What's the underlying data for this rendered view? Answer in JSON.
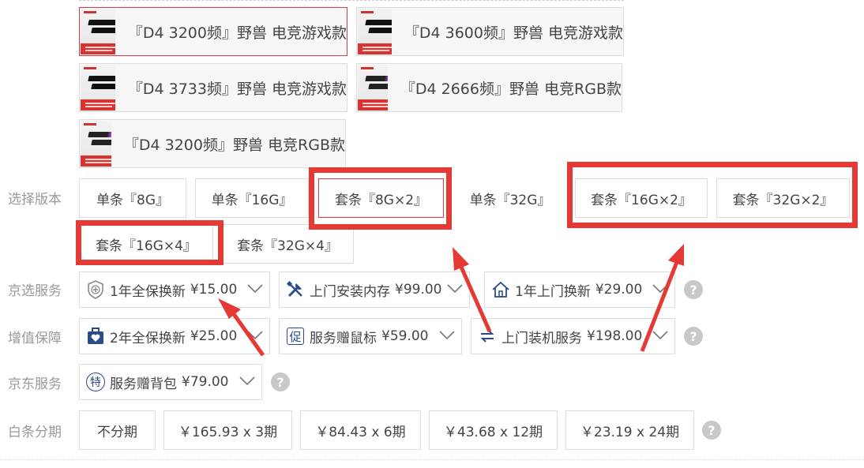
{
  "products": [
    {
      "name": "『D4 3200频』野兽 电竞游戏款",
      "selected": true,
      "rgb": false
    },
    {
      "name": "『D4 3600频』野兽 电竞游戏款",
      "selected": false,
      "rgb": false
    },
    {
      "name": "『D4 3733频』野兽 电竞游戏款",
      "selected": false,
      "rgb": false
    },
    {
      "name": "『D4 2666频』野兽 电竞RGB款",
      "selected": false,
      "rgb": true
    },
    {
      "name": "『D4 3200频』野兽 电竞RGB款",
      "selected": false,
      "rgb": true
    }
  ],
  "version": {
    "label": "选择版本",
    "options": [
      "单条『8G』",
      "单条『16G』",
      "套条『8G×2』",
      "单条『32G』",
      "套条『16G×2』",
      "套条『32G×2』",
      "套条『16G×4』",
      "套条『32G×4』"
    ],
    "selected": "套条『8G×2』"
  },
  "jingxuan": {
    "label": "京选服务",
    "items": [
      {
        "text": "1年全保换新",
        "price": "¥15.00",
        "icon": "shield-plus-icon"
      },
      {
        "text": "上门安装内存",
        "price": "¥99.00",
        "icon": "tools-icon"
      },
      {
        "text": "1年上门换新",
        "price": "¥29.00",
        "icon": "home-icon"
      }
    ]
  },
  "zengzhi": {
    "label": "增值保障",
    "items": [
      {
        "text": "2年全保换新",
        "price": "¥25.00",
        "icon": "heart-kit-icon"
      },
      {
        "text": "服务赠鼠标",
        "price": "¥59.00",
        "icon": "promo-icon",
        "icon_char": "促"
      },
      {
        "text": "上门装机服务",
        "price": "¥198.00",
        "icon": "swap-arrows-icon"
      }
    ]
  },
  "jdservice": {
    "label": "京东服务",
    "items": [
      {
        "text": "服务赠背包",
        "price": "¥79.00",
        "icon": "special-icon",
        "icon_char": "特"
      }
    ]
  },
  "baitiao": {
    "label": "白条分期",
    "options": [
      "不分期",
      "￥165.93 x 3期",
      "￥84.43 x 6期",
      "￥43.68 x 12期",
      "￥23.19 x 24期"
    ]
  },
  "colors": {
    "accent": "#e4393c",
    "annotation": "#e53935",
    "muted": "#999999"
  }
}
